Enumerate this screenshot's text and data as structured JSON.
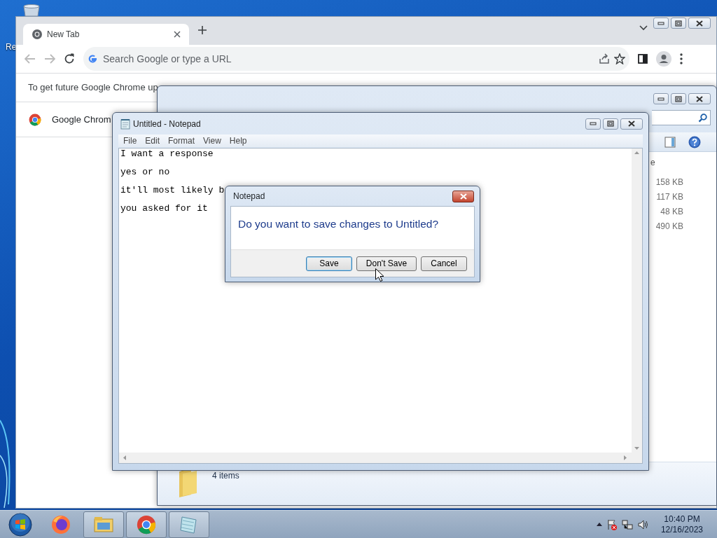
{
  "desktop": {
    "icon_label": "Re"
  },
  "chrome": {
    "tabs": [
      {
        "title": "New Tab",
        "selected": true
      }
    ],
    "omnibox": {
      "placeholder": "Search Google or type a URL"
    },
    "infobar": "To get future Google Chrome up",
    "shortcut": "Google Chrom"
  },
  "explorer": {
    "column_header": "e",
    "file_sizes": [
      "158 KB",
      "117 KB",
      "48 KB",
      "490 KB"
    ],
    "status": "4 items"
  },
  "notepad": {
    "title": "Untitled - Notepad",
    "menu": [
      "File",
      "Edit",
      "Format",
      "View",
      "Help"
    ],
    "lines": [
      "I want a response",
      "yes or no",
      "it'll most likely b",
      "you asked for it"
    ]
  },
  "dialog": {
    "title": "Notepad",
    "message": "Do you want to save changes to Untitled?",
    "buttons": [
      {
        "label": "Save",
        "default": true
      },
      {
        "label": "Don't Save",
        "default": false
      },
      {
        "label": "Cancel",
        "default": false
      }
    ]
  },
  "taskbar": {
    "apps": [
      {
        "kind": "firefox",
        "running": false
      },
      {
        "kind": "explorer",
        "running": true
      },
      {
        "kind": "chrome",
        "running": true
      },
      {
        "kind": "notepad",
        "running": true
      }
    ],
    "clock": {
      "time": "10:40 PM",
      "date": "12/16/2023"
    }
  }
}
